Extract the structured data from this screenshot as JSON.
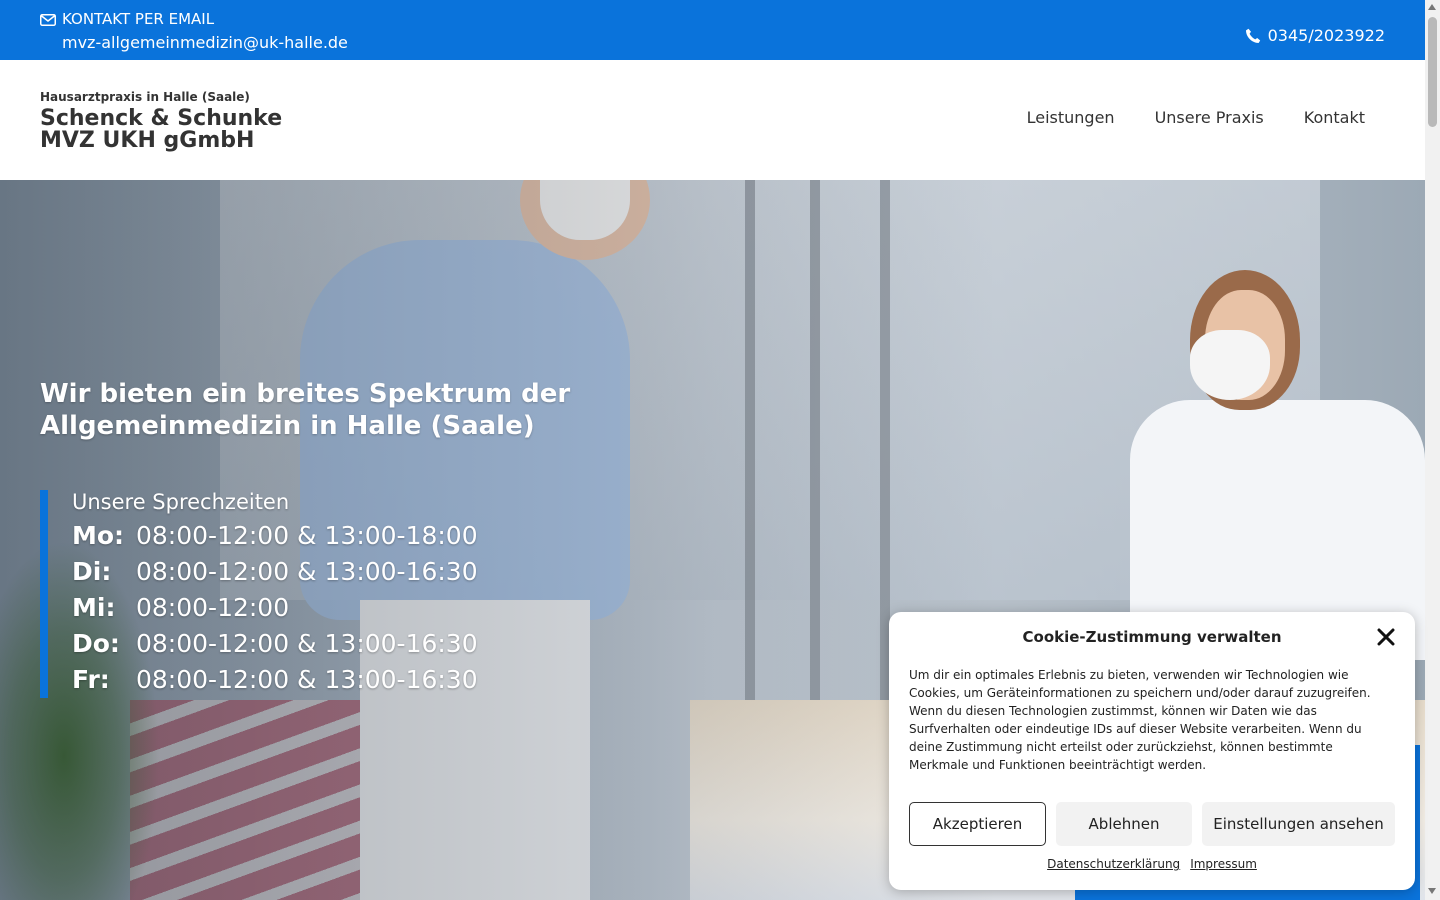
{
  "topbar": {
    "email_label": "KONTAKT PER EMAIL",
    "email_address": "mvz-allgemeinmedizin@uk-halle.de",
    "phone": "0345/2023922",
    "background_color": "#0a73db"
  },
  "header": {
    "tagline": "Hausarztpraxis in Halle (Saale)",
    "name_line1": "Schenck & Schunke",
    "name_line2": "MVZ UKH gGmbH"
  },
  "nav": {
    "items": [
      {
        "label": "Leistungen"
      },
      {
        "label": "Unsere Praxis"
      },
      {
        "label": "Kontakt"
      }
    ]
  },
  "hero": {
    "headline": "Wir bieten ein breites Spektrum der Allgemeinmedizin in Halle (Saale)",
    "hours_title": "Unsere Sprechzeiten",
    "hours": [
      {
        "day": "Mo:",
        "time": "08:00-12:00 & 13:00-18:00"
      },
      {
        "day": "Di:",
        "time": "08:00-12:00 & 13:00-16:30"
      },
      {
        "day": "Mi:",
        "time": "08:00-12:00"
      },
      {
        "day": "Do:",
        "time": "08:00-12:00 & 13:00-16:30"
      },
      {
        "day": "Fr:",
        "time": "08:00-12:00 & 13:00-16:30"
      }
    ]
  },
  "cookie": {
    "title": "Cookie-Zustimmung verwalten",
    "text": "Um dir ein optimales Erlebnis zu bieten, verwenden wir Technologien wie Cookies, um Geräteinformationen zu speichern und/oder darauf zuzugreifen. Wenn du diesen Technologien zustimmst, können wir Daten wie das Surfverhalten oder eindeutige IDs auf dieser Website verarbeiten. Wenn du deine Zustimmung nicht erteilst oder zurückziehst, können bestimmte Merkmale und Funktionen beeinträchtigt werden.",
    "accept_label": "Akzeptieren",
    "deny_label": "Ablehnen",
    "settings_label": "Einstellungen ansehen",
    "privacy_link": "Datenschutzerklärung",
    "imprint_link": "Impressum"
  },
  "icons": {
    "mail": "envelope-icon",
    "phone": "phone-icon",
    "close": "close-icon"
  }
}
